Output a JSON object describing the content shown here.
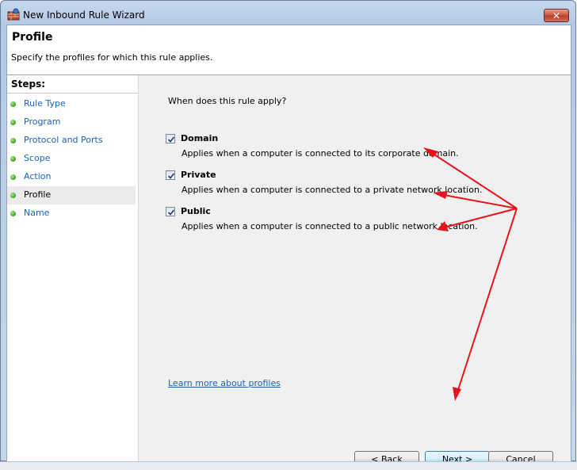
{
  "window": {
    "title": "New Inbound Rule Wizard",
    "close_glyph": "✕"
  },
  "header": {
    "title": "Profile",
    "description": "Specify the profiles for which this rule applies."
  },
  "sidebar": {
    "steps_label": "Steps:",
    "items": [
      {
        "label": "Rule Type"
      },
      {
        "label": "Program"
      },
      {
        "label": "Protocol and Ports"
      },
      {
        "label": "Scope"
      },
      {
        "label": "Action"
      },
      {
        "label": "Profile",
        "active": true
      },
      {
        "label": "Name"
      }
    ]
  },
  "content": {
    "question": "When does this rule apply?",
    "options": [
      {
        "label": "Domain",
        "checked": true,
        "description": "Applies when a computer is connected to its corporate domain."
      },
      {
        "label": "Private",
        "checked": true,
        "description": "Applies when a computer is connected to a private network location."
      },
      {
        "label": "Public",
        "checked": true,
        "description": "Applies when a computer is connected to a public network location."
      }
    ],
    "learn_more": "Learn more about profiles"
  },
  "buttons": {
    "back": "< Back",
    "next": "Next >",
    "cancel": "Cancel"
  },
  "colors": {
    "link": "#1863b5",
    "annotation_arrow": "#e8141b",
    "step_dot": "#3d9d22"
  },
  "icons": {
    "app": "firewall-icon",
    "close": "close-icon",
    "step": "green-dot-icon",
    "check": "checkmark-icon"
  }
}
